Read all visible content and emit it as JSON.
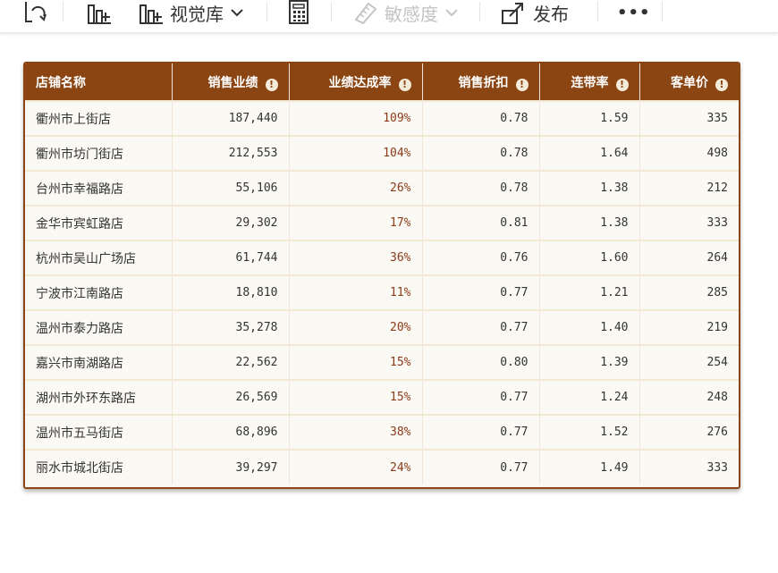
{
  "toolbar": {
    "library_label": "视觉库",
    "sensitivity_label": "敏感度",
    "publish_label": "发布",
    "more_label": "•••"
  },
  "table": {
    "headers": [
      "店铺名称",
      "销售业绩",
      "业绩达成率",
      "销售折扣",
      "连带率",
      "客单价"
    ],
    "info_glyph": "!",
    "rows": [
      [
        "衢州市上街店",
        "187,440",
        "109%",
        "0.78",
        "1.59",
        "335"
      ],
      [
        "衢州市坊门街店",
        "212,553",
        "104%",
        "0.78",
        "1.64",
        "498"
      ],
      [
        "台州市幸福路店",
        "55,106",
        "26%",
        "0.78",
        "1.38",
        "212"
      ],
      [
        "金华市宾虹路店",
        "29,302",
        "17%",
        "0.81",
        "1.38",
        "333"
      ],
      [
        "杭州市吴山广场店",
        "61,744",
        "36%",
        "0.76",
        "1.60",
        "264"
      ],
      [
        "宁波市江南路店",
        "18,810",
        "11%",
        "0.77",
        "1.21",
        "285"
      ],
      [
        "温州市泰力路店",
        "35,278",
        "20%",
        "0.77",
        "1.40",
        "219"
      ],
      [
        "嘉兴市南湖路店",
        "22,562",
        "15%",
        "0.80",
        "1.39",
        "254"
      ],
      [
        "湖州市外环东路店",
        "26,569",
        "15%",
        "0.77",
        "1.24",
        "248"
      ],
      [
        "温州市五马街店",
        "68,896",
        "38%",
        "0.77",
        "1.52",
        "276"
      ],
      [
        "丽水市城北街店",
        "39,297",
        "24%",
        "0.77",
        "1.49",
        "333"
      ]
    ]
  },
  "colors": {
    "header_bg": "#8b4513",
    "row_bg": "#fbf9f3",
    "rate_text": "#8b3a1a"
  }
}
